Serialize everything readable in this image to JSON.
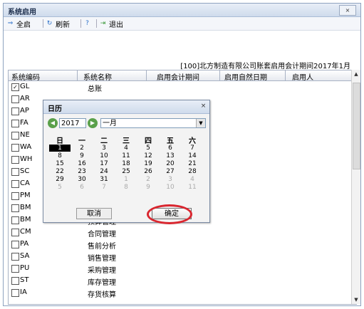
{
  "window": {
    "title": "系统启用",
    "close_label": "×"
  },
  "toolbar": {
    "items": [
      {
        "label": "全启",
        "icon": "enable-all-icon"
      },
      {
        "label": "刷新",
        "icon": "refresh-icon"
      },
      {
        "label": "",
        "icon": "help-icon"
      },
      {
        "label": "退出",
        "icon": "exit-icon"
      }
    ]
  },
  "info_text": "[100]北方制造有限公司账套启用会计期间2017年1月",
  "columns": [
    "系统编码",
    "系统名称",
    "启用会计期间",
    "启用自然日期",
    "启用人"
  ],
  "rows": [
    {
      "code": "GL",
      "name": "总账",
      "checked": true
    },
    {
      "code": "AR",
      "name": "",
      "checked": false
    },
    {
      "code": "AP",
      "name": "",
      "checked": false
    },
    {
      "code": "FA",
      "name": "",
      "checked": false
    },
    {
      "code": "NE",
      "name": "",
      "checked": false
    },
    {
      "code": "WA",
      "name": "",
      "checked": false
    },
    {
      "code": "WH",
      "name": "",
      "checked": false
    },
    {
      "code": "SC",
      "name": "",
      "checked": false
    },
    {
      "code": "CA",
      "name": "",
      "checked": false
    },
    {
      "code": "PM",
      "name": "",
      "checked": false
    },
    {
      "code": "BM",
      "name": "",
      "checked": false
    },
    {
      "code": "BM",
      "name": "预算管理",
      "checked": false
    },
    {
      "code": "CM",
      "name": "合同管理",
      "checked": false
    },
    {
      "code": "PA",
      "name": "售前分析",
      "checked": false
    },
    {
      "code": "SA",
      "name": "销售管理",
      "checked": false
    },
    {
      "code": "PU",
      "name": "采购管理",
      "checked": false
    },
    {
      "code": "ST",
      "name": "库存管理",
      "checked": false
    },
    {
      "code": "IA",
      "name": "存货核算",
      "checked": false
    }
  ],
  "calendar": {
    "title": "日历",
    "year": "2017",
    "month": "一月",
    "weekdays": [
      "日",
      "一",
      "二",
      "三",
      "四",
      "五",
      "六"
    ],
    "weeks": [
      [
        "1",
        "2",
        "3",
        "4",
        "5",
        "6",
        "7"
      ],
      [
        "8",
        "9",
        "10",
        "11",
        "12",
        "13",
        "14"
      ],
      [
        "15",
        "16",
        "17",
        "18",
        "19",
        "20",
        "21"
      ],
      [
        "22",
        "23",
        "24",
        "25",
        "26",
        "27",
        "28"
      ],
      [
        "29",
        "30",
        "31",
        "1",
        "2",
        "3",
        "4"
      ],
      [
        "5",
        "6",
        "7",
        "8",
        "9",
        "10",
        "11"
      ]
    ],
    "selected_day": "1",
    "cancel_label": "取消",
    "ok_label": "确定"
  }
}
